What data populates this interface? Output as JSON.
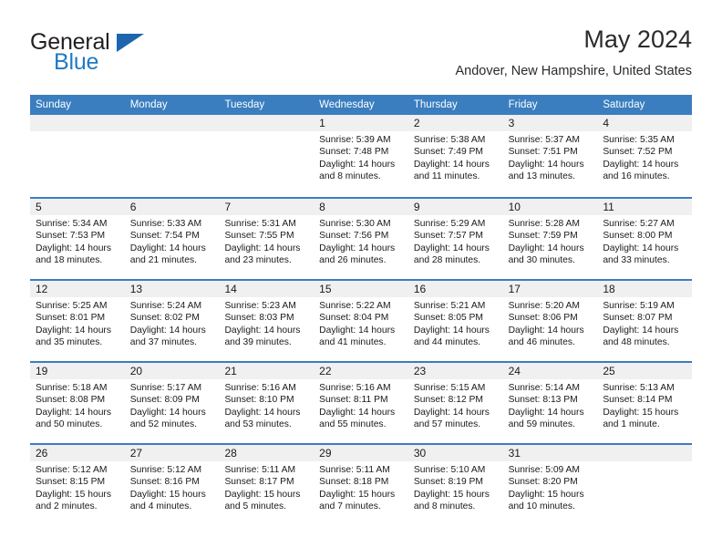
{
  "brand": {
    "name_part1": "General",
    "name_part2": "Blue",
    "triangle_color": "#1d66ad",
    "blue_color": "#1f7ac4"
  },
  "header": {
    "title": "May 2024",
    "subtitle": "Andover, New Hampshire, United States"
  },
  "theme": {
    "header_bar": "#3a7ebf",
    "day_band": "#f0f0f0",
    "row_divider": "#3a7ebf"
  },
  "weekdays": [
    "Sunday",
    "Monday",
    "Tuesday",
    "Wednesday",
    "Thursday",
    "Friday",
    "Saturday"
  ],
  "labels": {
    "sunrise": "Sunrise:",
    "sunset": "Sunset:",
    "daylight": "Daylight:"
  },
  "weeks": [
    [
      {
        "day": "",
        "empty": true
      },
      {
        "day": "",
        "empty": true
      },
      {
        "day": "",
        "empty": true
      },
      {
        "day": "1",
        "sunrise": "Sunrise: 5:39 AM",
        "sunset": "Sunset: 7:48 PM",
        "daylight": "Daylight: 14 hours and 8 minutes."
      },
      {
        "day": "2",
        "sunrise": "Sunrise: 5:38 AM",
        "sunset": "Sunset: 7:49 PM",
        "daylight": "Daylight: 14 hours and 11 minutes."
      },
      {
        "day": "3",
        "sunrise": "Sunrise: 5:37 AM",
        "sunset": "Sunset: 7:51 PM",
        "daylight": "Daylight: 14 hours and 13 minutes."
      },
      {
        "day": "4",
        "sunrise": "Sunrise: 5:35 AM",
        "sunset": "Sunset: 7:52 PM",
        "daylight": "Daylight: 14 hours and 16 minutes."
      }
    ],
    [
      {
        "day": "5",
        "sunrise": "Sunrise: 5:34 AM",
        "sunset": "Sunset: 7:53 PM",
        "daylight": "Daylight: 14 hours and 18 minutes."
      },
      {
        "day": "6",
        "sunrise": "Sunrise: 5:33 AM",
        "sunset": "Sunset: 7:54 PM",
        "daylight": "Daylight: 14 hours and 21 minutes."
      },
      {
        "day": "7",
        "sunrise": "Sunrise: 5:31 AM",
        "sunset": "Sunset: 7:55 PM",
        "daylight": "Daylight: 14 hours and 23 minutes."
      },
      {
        "day": "8",
        "sunrise": "Sunrise: 5:30 AM",
        "sunset": "Sunset: 7:56 PM",
        "daylight": "Daylight: 14 hours and 26 minutes."
      },
      {
        "day": "9",
        "sunrise": "Sunrise: 5:29 AM",
        "sunset": "Sunset: 7:57 PM",
        "daylight": "Daylight: 14 hours and 28 minutes."
      },
      {
        "day": "10",
        "sunrise": "Sunrise: 5:28 AM",
        "sunset": "Sunset: 7:59 PM",
        "daylight": "Daylight: 14 hours and 30 minutes."
      },
      {
        "day": "11",
        "sunrise": "Sunrise: 5:27 AM",
        "sunset": "Sunset: 8:00 PM",
        "daylight": "Daylight: 14 hours and 33 minutes."
      }
    ],
    [
      {
        "day": "12",
        "sunrise": "Sunrise: 5:25 AM",
        "sunset": "Sunset: 8:01 PM",
        "daylight": "Daylight: 14 hours and 35 minutes."
      },
      {
        "day": "13",
        "sunrise": "Sunrise: 5:24 AM",
        "sunset": "Sunset: 8:02 PM",
        "daylight": "Daylight: 14 hours and 37 minutes."
      },
      {
        "day": "14",
        "sunrise": "Sunrise: 5:23 AM",
        "sunset": "Sunset: 8:03 PM",
        "daylight": "Daylight: 14 hours and 39 minutes."
      },
      {
        "day": "15",
        "sunrise": "Sunrise: 5:22 AM",
        "sunset": "Sunset: 8:04 PM",
        "daylight": "Daylight: 14 hours and 41 minutes."
      },
      {
        "day": "16",
        "sunrise": "Sunrise: 5:21 AM",
        "sunset": "Sunset: 8:05 PM",
        "daylight": "Daylight: 14 hours and 44 minutes."
      },
      {
        "day": "17",
        "sunrise": "Sunrise: 5:20 AM",
        "sunset": "Sunset: 8:06 PM",
        "daylight": "Daylight: 14 hours and 46 minutes."
      },
      {
        "day": "18",
        "sunrise": "Sunrise: 5:19 AM",
        "sunset": "Sunset: 8:07 PM",
        "daylight": "Daylight: 14 hours and 48 minutes."
      }
    ],
    [
      {
        "day": "19",
        "sunrise": "Sunrise: 5:18 AM",
        "sunset": "Sunset: 8:08 PM",
        "daylight": "Daylight: 14 hours and 50 minutes."
      },
      {
        "day": "20",
        "sunrise": "Sunrise: 5:17 AM",
        "sunset": "Sunset: 8:09 PM",
        "daylight": "Daylight: 14 hours and 52 minutes."
      },
      {
        "day": "21",
        "sunrise": "Sunrise: 5:16 AM",
        "sunset": "Sunset: 8:10 PM",
        "daylight": "Daylight: 14 hours and 53 minutes."
      },
      {
        "day": "22",
        "sunrise": "Sunrise: 5:16 AM",
        "sunset": "Sunset: 8:11 PM",
        "daylight": "Daylight: 14 hours and 55 minutes."
      },
      {
        "day": "23",
        "sunrise": "Sunrise: 5:15 AM",
        "sunset": "Sunset: 8:12 PM",
        "daylight": "Daylight: 14 hours and 57 minutes."
      },
      {
        "day": "24",
        "sunrise": "Sunrise: 5:14 AM",
        "sunset": "Sunset: 8:13 PM",
        "daylight": "Daylight: 14 hours and 59 minutes."
      },
      {
        "day": "25",
        "sunrise": "Sunrise: 5:13 AM",
        "sunset": "Sunset: 8:14 PM",
        "daylight": "Daylight: 15 hours and 1 minute."
      }
    ],
    [
      {
        "day": "26",
        "sunrise": "Sunrise: 5:12 AM",
        "sunset": "Sunset: 8:15 PM",
        "daylight": "Daylight: 15 hours and 2 minutes."
      },
      {
        "day": "27",
        "sunrise": "Sunrise: 5:12 AM",
        "sunset": "Sunset: 8:16 PM",
        "daylight": "Daylight: 15 hours and 4 minutes."
      },
      {
        "day": "28",
        "sunrise": "Sunrise: 5:11 AM",
        "sunset": "Sunset: 8:17 PM",
        "daylight": "Daylight: 15 hours and 5 minutes."
      },
      {
        "day": "29",
        "sunrise": "Sunrise: 5:11 AM",
        "sunset": "Sunset: 8:18 PM",
        "daylight": "Daylight: 15 hours and 7 minutes."
      },
      {
        "day": "30",
        "sunrise": "Sunrise: 5:10 AM",
        "sunset": "Sunset: 8:19 PM",
        "daylight": "Daylight: 15 hours and 8 minutes."
      },
      {
        "day": "31",
        "sunrise": "Sunrise: 5:09 AM",
        "sunset": "Sunset: 8:20 PM",
        "daylight": "Daylight: 15 hours and 10 minutes."
      },
      {
        "day": "",
        "empty": true
      }
    ]
  ]
}
